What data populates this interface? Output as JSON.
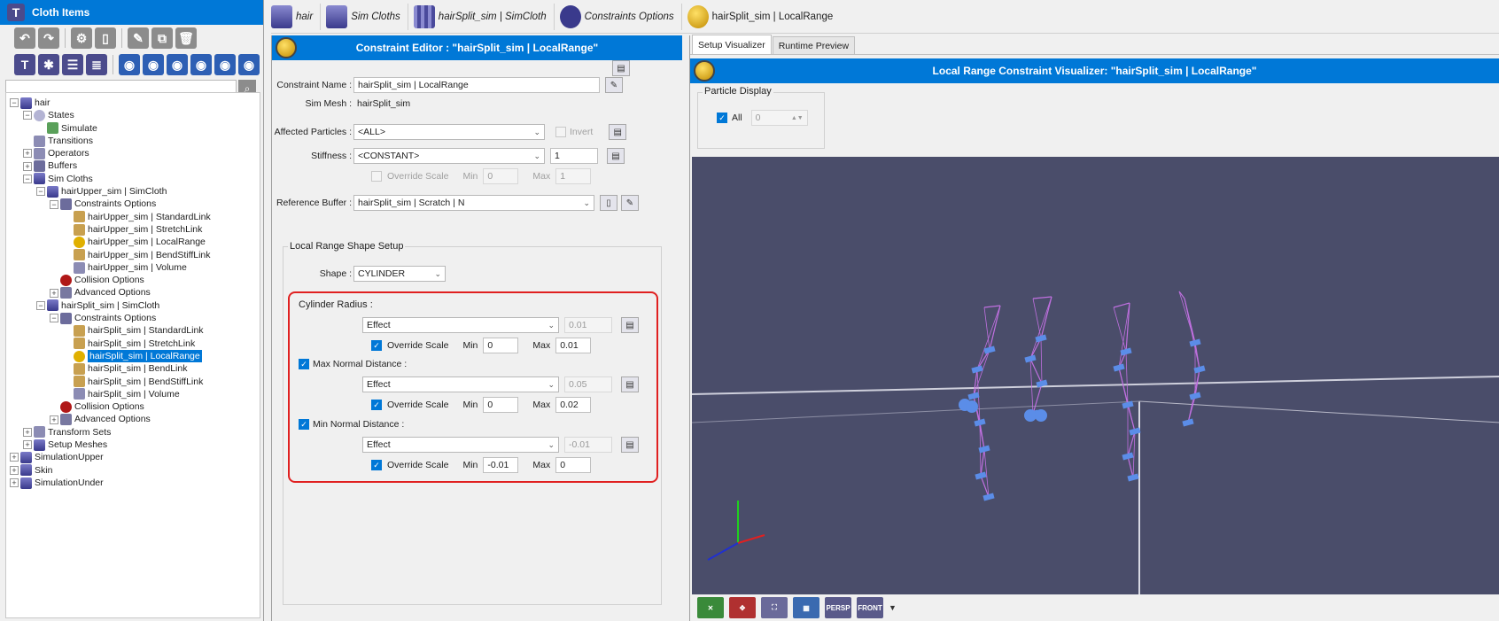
{
  "left_panel": {
    "title": "Cloth Items",
    "tree": [
      {
        "label": "hair",
        "depth": 0,
        "expander": "-",
        "icon": "cloth"
      },
      {
        "label": "States",
        "depth": 1,
        "expander": "-",
        "icon": "state"
      },
      {
        "label": "Simulate",
        "depth": 2,
        "expander": "",
        "icon": "sim"
      },
      {
        "label": "Transitions",
        "depth": 1,
        "expander": "",
        "icon": "op"
      },
      {
        "label": "Operators",
        "depth": 1,
        "expander": "+",
        "icon": "op"
      },
      {
        "label": "Buffers",
        "depth": 1,
        "expander": "+",
        "icon": "buf"
      },
      {
        "label": "Sim Cloths",
        "depth": 1,
        "expander": "-",
        "icon": "cloth"
      },
      {
        "label": "hairUpper_sim | SimCloth",
        "depth": 2,
        "expander": "-",
        "icon": "cloth"
      },
      {
        "label": "Constraints Options",
        "depth": 3,
        "expander": "-",
        "icon": "buf"
      },
      {
        "label": "hairUpper_sim | StandardLink",
        "depth": 4,
        "expander": "",
        "icon": "link"
      },
      {
        "label": "hairUpper_sim | StretchLink",
        "depth": 4,
        "expander": "",
        "icon": "link"
      },
      {
        "label": "hairUpper_sim | LocalRange",
        "depth": 4,
        "expander": "",
        "icon": "range"
      },
      {
        "label": "hairUpper_sim | BendStiffLink",
        "depth": 4,
        "expander": "",
        "icon": "link"
      },
      {
        "label": "hairUpper_sim | Volume",
        "depth": 4,
        "expander": "",
        "icon": "op"
      },
      {
        "label": "Collision Options",
        "depth": 3,
        "expander": "",
        "icon": "coll"
      },
      {
        "label": "Advanced Options",
        "depth": 3,
        "expander": "+",
        "icon": "adv"
      },
      {
        "label": "hairSplit_sim | SimCloth",
        "depth": 2,
        "expander": "-",
        "icon": "cloth"
      },
      {
        "label": "Constraints Options",
        "depth": 3,
        "expander": "-",
        "icon": "buf"
      },
      {
        "label": "hairSplit_sim | StandardLink",
        "depth": 4,
        "expander": "",
        "icon": "link"
      },
      {
        "label": "hairSplit_sim | StretchLink",
        "depth": 4,
        "expander": "",
        "icon": "link"
      },
      {
        "label": "hairSplit_sim | LocalRange",
        "depth": 4,
        "expander": "",
        "icon": "range",
        "selected": true
      },
      {
        "label": "hairSplit_sim | BendLink",
        "depth": 4,
        "expander": "",
        "icon": "link"
      },
      {
        "label": "hairSplit_sim | BendStiffLink",
        "depth": 4,
        "expander": "",
        "icon": "link"
      },
      {
        "label": "hairSplit_sim | Volume",
        "depth": 4,
        "expander": "",
        "icon": "op"
      },
      {
        "label": "Collision Options",
        "depth": 3,
        "expander": "",
        "icon": "coll"
      },
      {
        "label": "Advanced Options",
        "depth": 3,
        "expander": "+",
        "icon": "adv"
      },
      {
        "label": "Transform Sets",
        "depth": 1,
        "expander": "+",
        "icon": "op"
      },
      {
        "label": "Setup Meshes",
        "depth": 1,
        "expander": "+",
        "icon": "cloth"
      },
      {
        "label": "SimulationUpper",
        "depth": 0,
        "expander": "+",
        "icon": "cloth"
      },
      {
        "label": "Skin",
        "depth": 0,
        "expander": "+",
        "icon": "cloth"
      },
      {
        "label": "SimulationUnder",
        "depth": 0,
        "expander": "+",
        "icon": "cloth"
      }
    ]
  },
  "breadcrumbs": [
    "hair",
    "Sim Cloths",
    "hairSplit_sim | SimCloth",
    "Constraints Options",
    "hairSplit_sim | LocalRange"
  ],
  "editor": {
    "title": "Constraint Editor : \"hairSplit_sim | LocalRange\"",
    "constraint_name_label": "Constraint Name :",
    "constraint_name_value": "hairSplit_sim | LocalRange",
    "sim_mesh_label": "Sim Mesh :",
    "sim_mesh_value": "hairSplit_sim",
    "affected_label": "Affected Particles :",
    "affected_value": "<ALL>",
    "invert_label": "Invert",
    "stiffness_label": "Stiffness :",
    "stiffness_value": "<CONSTANT>",
    "stiffness_number": "1",
    "override_scale_label": "Override Scale",
    "min_label": "Min",
    "max_label": "Max",
    "stiffness_min": "0",
    "stiffness_max": "1",
    "reference_label": "Reference Buffer :",
    "reference_value": "hairSplit_sim | Scratch | N",
    "shape_setup_label": "Local Range Shape Setup",
    "shape_label": "Shape :",
    "shape_value": "CYLINDER",
    "cylinder_radius_label": "Cylinder Radius :",
    "cylinder_effect": "Effect",
    "cylinder_value": "0.01",
    "cylinder_min": "0",
    "cylinder_max": "0.01",
    "max_normal_label": "Max Normal Distance :",
    "max_normal_effect": "Effect",
    "max_normal_value": "0.05",
    "max_normal_min": "0",
    "max_normal_max": "0.02",
    "min_normal_label": "Min Normal Distance :",
    "min_normal_effect": "Effect",
    "min_normal_value": "-0.01",
    "min_normal_min": "-0.01",
    "min_normal_max": "0"
  },
  "visualizer": {
    "tabs": [
      "Setup Visualizer",
      "Runtime Preview"
    ],
    "active_tab": "Setup Visualizer",
    "title": "Local Range Constraint Visualizer: \"hairSplit_sim | LocalRange\"",
    "particle_display_label": "Particle Display",
    "all_label": "All",
    "all_value": "0",
    "toolbar": [
      "PERSP",
      "FRONT"
    ]
  },
  "colors": {
    "title_blue": "#0078d7",
    "viewport_bg": "#4a4d6a",
    "highlight_red": "#e02020",
    "particle_blue": "#5b8de8",
    "link_magenta": "#c070e0"
  }
}
